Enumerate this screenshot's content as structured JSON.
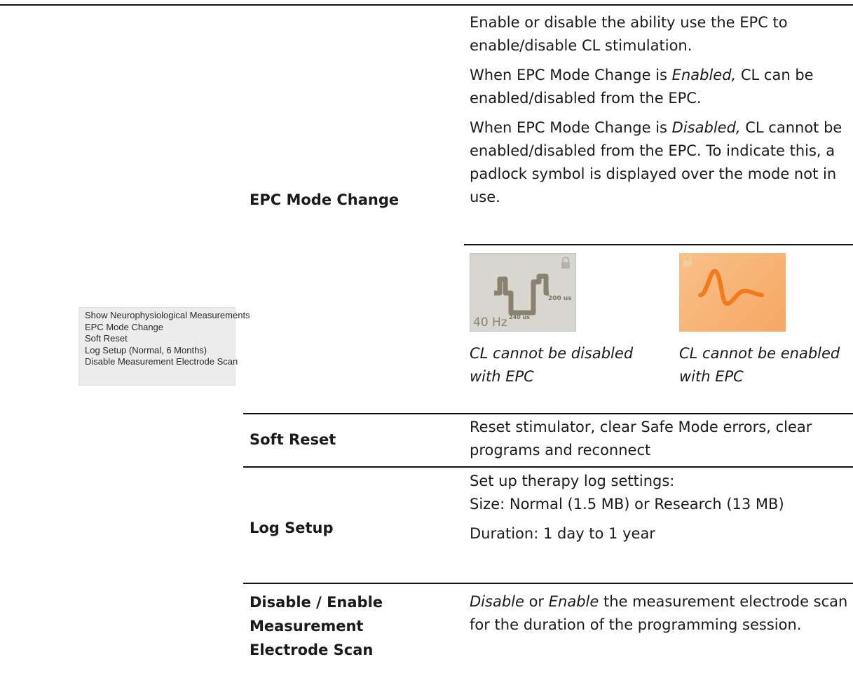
{
  "menu": {
    "items": [
      "Show Neurophysiological Measurements",
      "EPC Mode Change",
      "Soft Reset",
      "Log Setup (Normal, 6 Months)",
      "Disable Measurement Electrode Scan"
    ]
  },
  "rows": {
    "epc": {
      "label": "EPC Mode Change",
      "p1": "Enable or disable the ability use the EPC to enable/disable CL stimulation.",
      "p2_pre": "When EPC Mode Change is ",
      "p2_em": "Enabled,",
      "p2_post": " CL can be enabled/disabled from the EPC.",
      "p3_pre": "When EPC Mode Change is ",
      "p3_em": "Disabled,",
      "p3_post": " CL cannot be enabled/disabled from the EPC. To indicate this, a padlock symbol is displayed over the mode not in use."
    },
    "tiles": {
      "cl": {
        "hz": "40 Hz",
        "us_top": "200 us",
        "us_bottom": "240 us",
        "caption": "CL cannot be disabled with EPC",
        "icon": "square-pulse-waveform"
      },
      "epc": {
        "caption": "CL cannot be enabled with EPC",
        "icon": "ecap-waveform",
        "accent": "#f07a1c"
      }
    },
    "soft_reset": {
      "label": "Soft Reset",
      "desc": "Reset stimulator, clear Safe Mode errors, clear programs and reconnect"
    },
    "log_setup": {
      "label": "Log Setup",
      "line1": "Set up therapy log settings:",
      "line2": "Size: Normal (1.5 MB) or Research (13 MB)",
      "line3": "Duration: 1 day to 1 year"
    },
    "scan": {
      "label": "Disable / Enable Measurement Electrode Scan",
      "em1": "Disable",
      "mid": " or ",
      "em2": "Enable",
      "post": " the measurement electrode scan for the duration of the programming session."
    }
  }
}
